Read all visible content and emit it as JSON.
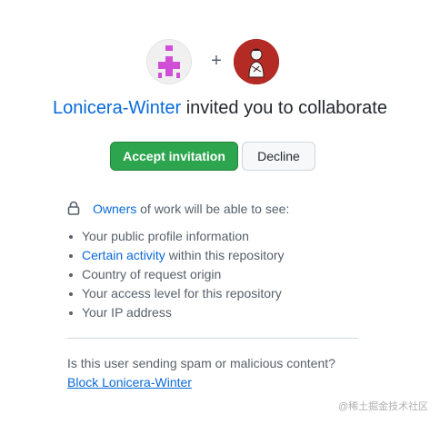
{
  "header": {
    "inviter_avatar_icon": "identicon-avatar",
    "invitee_avatar_icon": "user-avatar",
    "plus": "+"
  },
  "invitation": {
    "inviter": "Lonicera-Winter",
    "message": " invited you to collaborate"
  },
  "actions": {
    "accept_label": "Accept invitation",
    "decline_label": "Decline"
  },
  "privacy": {
    "lock_icon": "lock-icon",
    "owners_link": "Owners",
    "owners_text": " of work will be able to see:",
    "items": [
      {
        "text": "Your public profile information"
      },
      {
        "link": "Certain activity",
        "text": " within this repository"
      },
      {
        "text": "Country of request origin"
      },
      {
        "text": "Your access level for this repository"
      },
      {
        "text": "Your IP address"
      }
    ]
  },
  "report": {
    "question": "Is this user sending spam or malicious content?",
    "block_link": "Block Lonicera-Winter"
  },
  "watermark": "@稀土掘金技术社区",
  "colors": {
    "accent_link": "#0969da",
    "accept_bg": "#2da44e",
    "identicon": "#d14fd6",
    "avatar_bg": "#b42a24"
  }
}
